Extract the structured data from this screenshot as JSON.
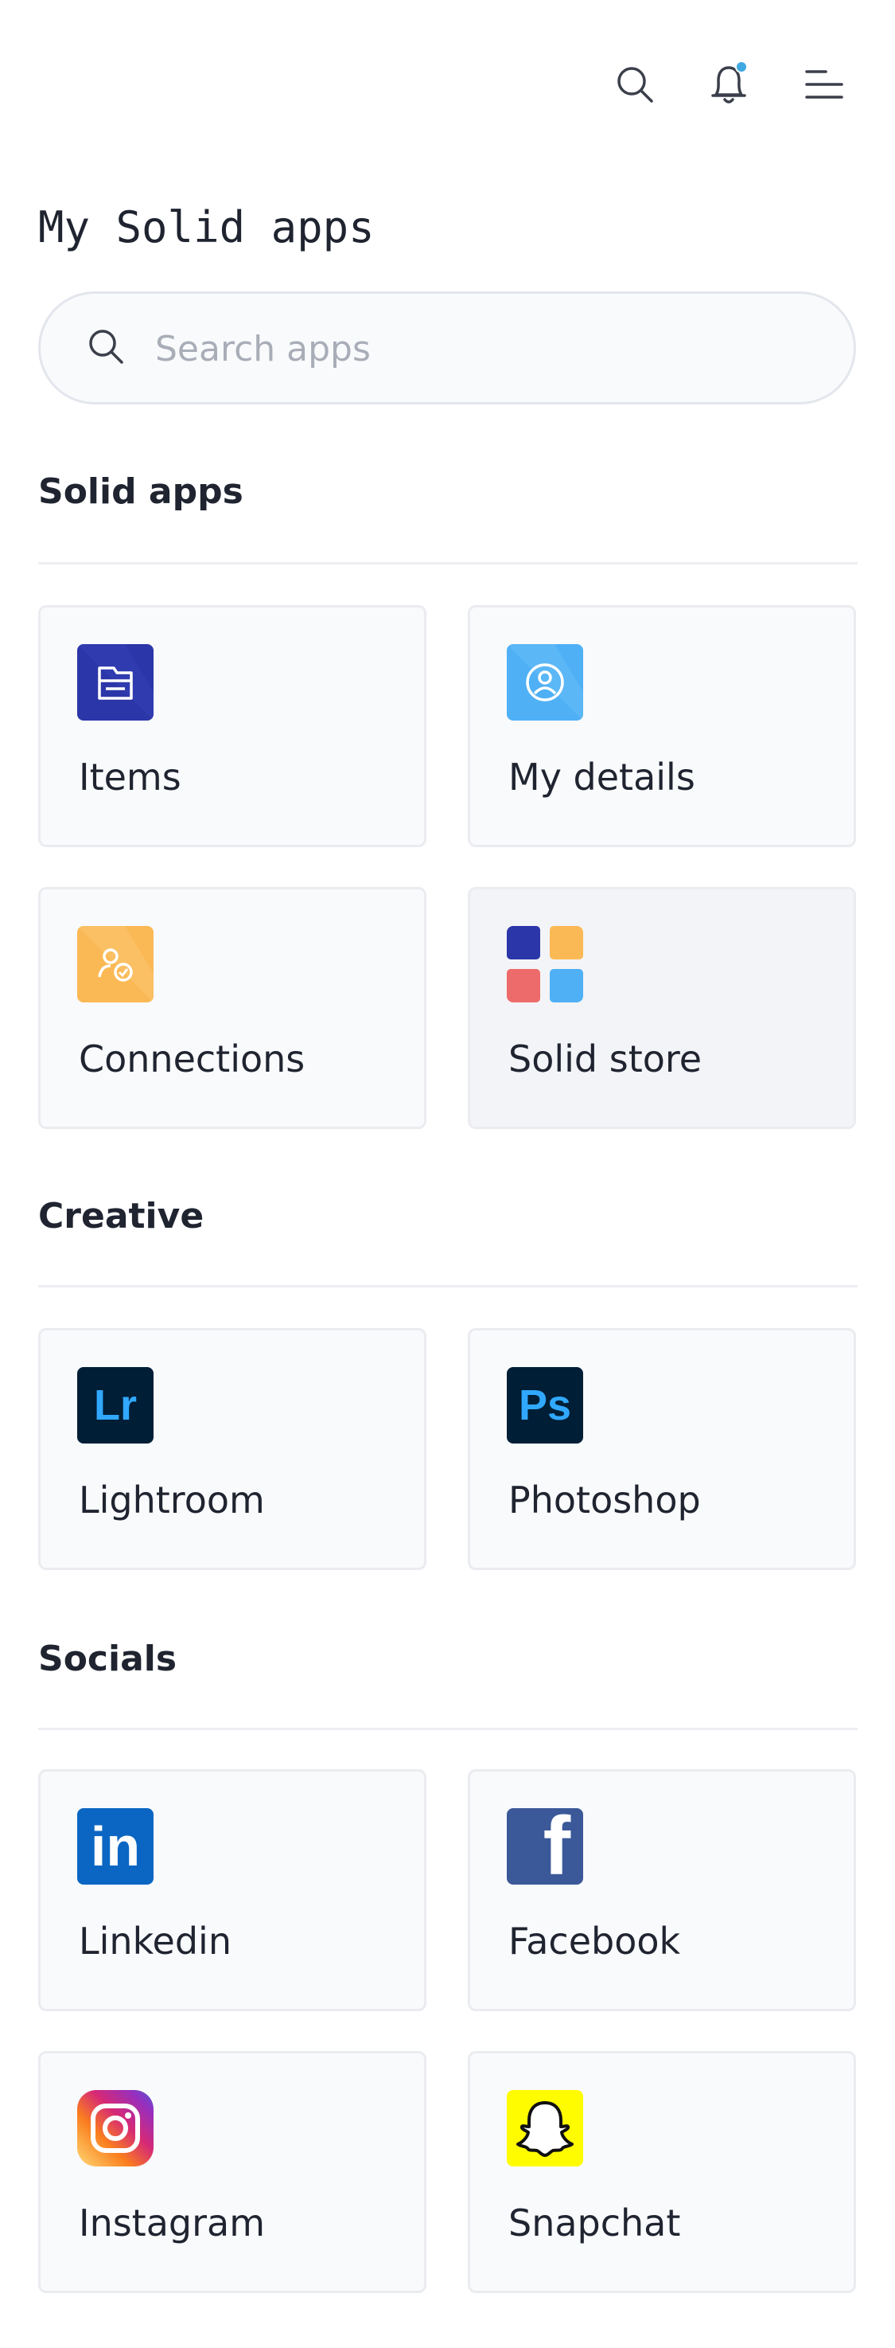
{
  "header": {
    "title": "My Solid apps",
    "icons": [
      "search-icon",
      "bell-icon",
      "menu-icon"
    ],
    "notification_dot_color": "#3fa9e0"
  },
  "search": {
    "placeholder": "Search apps",
    "value": ""
  },
  "sections": [
    {
      "title": "Solid apps",
      "apps": [
        {
          "label": "Items",
          "icon": "items-folder-icon",
          "color": "#2b36a8"
        },
        {
          "label": "My details",
          "icon": "user-circle-icon",
          "color": "#4fb0f5"
        },
        {
          "label": "Connections",
          "icon": "connections-icon",
          "color": "#fbb955"
        },
        {
          "label": "Solid store",
          "icon": "store-grid-icon",
          "color": "#2b36a8"
        }
      ]
    },
    {
      "title": "Creative",
      "apps": [
        {
          "label": "Lightroom",
          "icon": "lightroom-icon",
          "badge": "Lr",
          "color": "#001e36"
        },
        {
          "label": "Photoshop",
          "icon": "photoshop-icon",
          "badge": "Ps",
          "color": "#001e36"
        }
      ]
    },
    {
      "title": "Socials",
      "apps": [
        {
          "label": "Linkedin",
          "icon": "linkedin-icon",
          "badge": "in",
          "color": "#0a66c2"
        },
        {
          "label": "Facebook",
          "icon": "facebook-icon",
          "badge": "f",
          "color": "#3b5998"
        },
        {
          "label": "Instagram",
          "icon": "instagram-icon",
          "color": "#d62976"
        },
        {
          "label": "Snapchat",
          "icon": "snapchat-icon",
          "color": "#fffc00"
        }
      ]
    }
  ]
}
